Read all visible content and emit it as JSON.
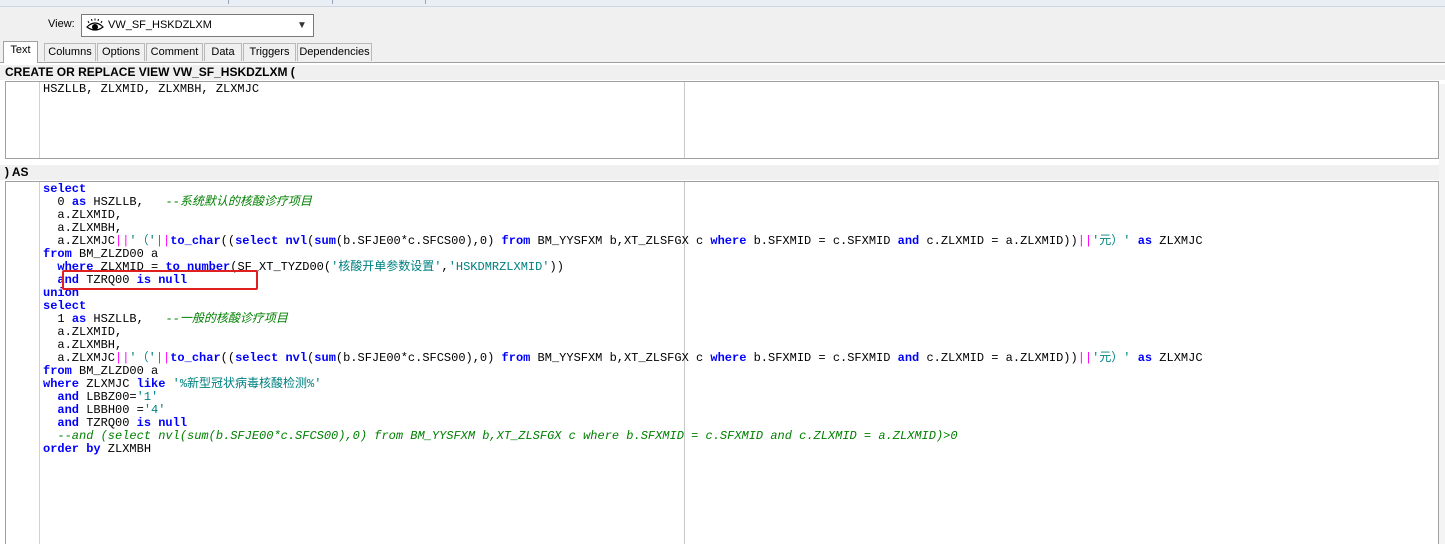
{
  "viewbar": {
    "label": "View:",
    "selected_view": "VW_SF_HSKDZLXM"
  },
  "tabs": [
    "Text",
    "Columns",
    "Options",
    "Comment",
    "Data",
    "Triggers",
    "Dependencies"
  ],
  "active_tab": "Text",
  "header_top": "CREATE OR REPLACE VIEW VW_SF_HSKDZLXM (",
  "header_columns": "HSZLLB, ZLXMID, ZLXMBH, ZLXMJC",
  "header_as": ") AS",
  "code_lines": [
    [
      [
        "kw",
        "select"
      ]
    ],
    [
      [
        "t",
        "  0 "
      ],
      [
        "kw",
        "as"
      ],
      [
        "t",
        " HSZLLB,   "
      ],
      [
        "cm",
        "--系统默认的核酸诊疗项目"
      ]
    ],
    [
      [
        "t",
        "  a.ZLXMID,"
      ]
    ],
    [
      [
        "t",
        "  a.ZLXMBH,"
      ]
    ],
    [
      [
        "t",
        "  a.ZLXMJC"
      ],
      [
        "op",
        "||"
      ],
      [
        "str",
        "'（'"
      ],
      [
        "op",
        "||"
      ],
      [
        "kw",
        "to_char"
      ],
      [
        "t",
        "(("
      ],
      [
        "kw",
        "select"
      ],
      [
        "t",
        " "
      ],
      [
        "kw",
        "nvl"
      ],
      [
        "t",
        "("
      ],
      [
        "kw",
        "sum"
      ],
      [
        "t",
        "(b.SFJE00*c.SFCS00),0) "
      ],
      [
        "kw",
        "from"
      ],
      [
        "t",
        " BM_YYSFXM b,XT_ZLSFGX c "
      ],
      [
        "kw",
        "where"
      ],
      [
        "t",
        " b.SFXMID = c.SFXMID "
      ],
      [
        "kw",
        "and"
      ],
      [
        "t",
        " c.ZLXMID = a.ZLXMID))"
      ],
      [
        "op",
        "||"
      ],
      [
        "str",
        "'元）'"
      ],
      [
        "t",
        " "
      ],
      [
        "kw",
        "as"
      ],
      [
        "t",
        " ZLXMJC"
      ]
    ],
    [
      [
        "kw",
        "from"
      ],
      [
        "t",
        " BM_ZLZD00 a"
      ]
    ],
    [
      [
        "t",
        "  "
      ],
      [
        "kw",
        "where"
      ],
      [
        "t",
        " ZLXMID = "
      ],
      [
        "kw",
        "to_number"
      ],
      [
        "t",
        "(SF_XT_TYZD00("
      ],
      [
        "str",
        "'核酸开单参数设置'"
      ],
      [
        "t",
        ","
      ],
      [
        "str",
        "'HSKDMRZLXMID'"
      ],
      [
        "t",
        "))"
      ]
    ],
    [
      [
        "t",
        "  "
      ],
      [
        "kw",
        "and"
      ],
      [
        "t",
        " TZRQ00 "
      ],
      [
        "kw",
        "is"
      ],
      [
        "t",
        " "
      ],
      [
        "kw",
        "null"
      ]
    ],
    [
      [
        "kw",
        "union"
      ]
    ],
    [
      [
        "kw",
        "select"
      ]
    ],
    [
      [
        "t",
        "  1 "
      ],
      [
        "kw",
        "as"
      ],
      [
        "t",
        " HSZLLB,   "
      ],
      [
        "cm",
        "--一般的核酸诊疗项目"
      ]
    ],
    [
      [
        "t",
        "  a.ZLXMID,"
      ]
    ],
    [
      [
        "t",
        "  a.ZLXMBH,"
      ]
    ],
    [
      [
        "t",
        "  a.ZLXMJC"
      ],
      [
        "op",
        "||"
      ],
      [
        "str",
        "'（'"
      ],
      [
        "op",
        "||"
      ],
      [
        "kw",
        "to_char"
      ],
      [
        "t",
        "(("
      ],
      [
        "kw",
        "select"
      ],
      [
        "t",
        " "
      ],
      [
        "kw",
        "nvl"
      ],
      [
        "t",
        "("
      ],
      [
        "kw",
        "sum"
      ],
      [
        "t",
        "(b.SFJE00*c.SFCS00),0) "
      ],
      [
        "kw",
        "from"
      ],
      [
        "t",
        " BM_YYSFXM b,XT_ZLSFGX c "
      ],
      [
        "kw",
        "where"
      ],
      [
        "t",
        " b.SFXMID = c.SFXMID "
      ],
      [
        "kw",
        "and"
      ],
      [
        "t",
        " c.ZLXMID = a.ZLXMID))"
      ],
      [
        "op",
        "||"
      ],
      [
        "str",
        "'元）'"
      ],
      [
        "t",
        " "
      ],
      [
        "kw",
        "as"
      ],
      [
        "t",
        " ZLXMJC"
      ]
    ],
    [
      [
        "kw",
        "from"
      ],
      [
        "t",
        " BM_ZLZD00 a"
      ]
    ],
    [
      [
        "kw",
        "where"
      ],
      [
        "t",
        " ZLXMJC "
      ],
      [
        "kw",
        "like"
      ],
      [
        "t",
        " "
      ],
      [
        "str",
        "'%新型冠状病毒核酸检测%'"
      ]
    ],
    [
      [
        "t",
        "  "
      ],
      [
        "kw",
        "and"
      ],
      [
        "t",
        " LBBZ00="
      ],
      [
        "str",
        "'1'"
      ]
    ],
    [
      [
        "t",
        "  "
      ],
      [
        "kw",
        "and"
      ],
      [
        "t",
        " LBBH00 ="
      ],
      [
        "str",
        "'4'"
      ]
    ],
    [
      [
        "t",
        "  "
      ],
      [
        "kw",
        "and"
      ],
      [
        "t",
        " TZRQ00 "
      ],
      [
        "kw",
        "is"
      ],
      [
        "t",
        " "
      ],
      [
        "kw",
        "null"
      ]
    ],
    [
      [
        "cm",
        "  --and (select nvl(sum(b.SFJE00*c.SFCS00),0) from BM_YYSFXM b,XT_ZLSFGX c where b.SFXMID = c.SFXMID and c.ZLXMID = a.ZLXMID)>0"
      ]
    ],
    [
      [
        "kw",
        "order by"
      ],
      [
        "t",
        " ZLXMBH"
      ]
    ]
  ],
  "colors": {
    "keyword": "#0000ff",
    "string": "#008080",
    "comment": "#008000",
    "operator": "#ff00ff",
    "highlight_box": "#e02020"
  }
}
